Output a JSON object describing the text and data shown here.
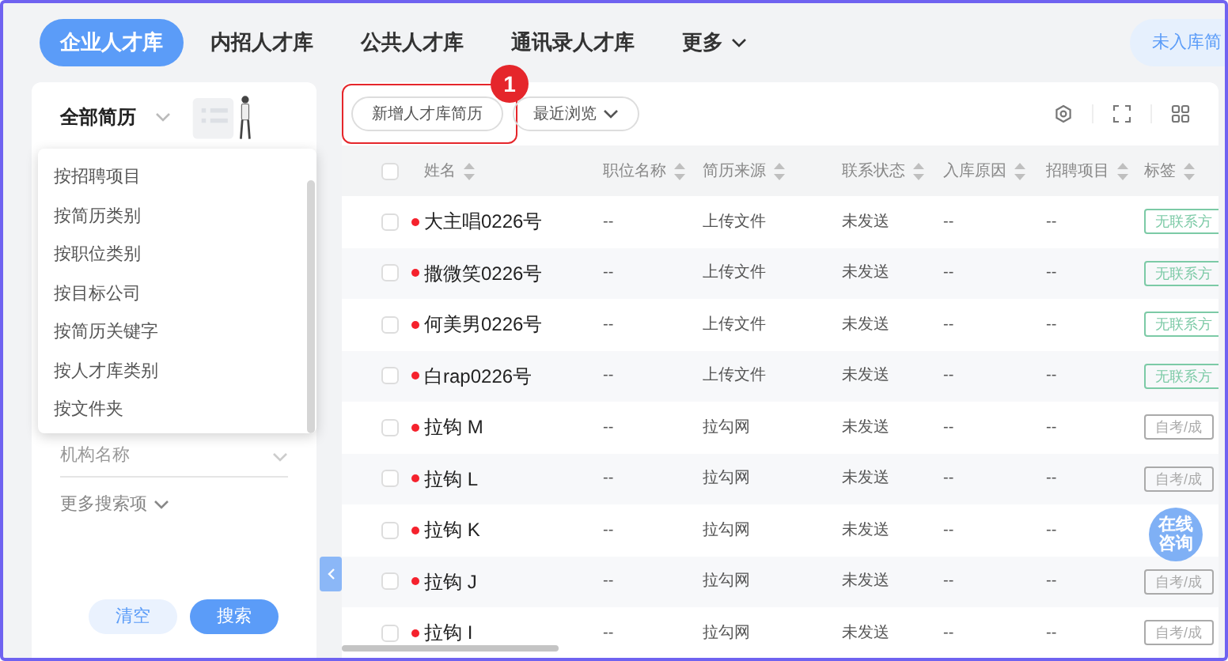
{
  "tabs": [
    {
      "label": "企业人才库",
      "selected": true
    },
    {
      "label": "内招人才库",
      "selected": false
    },
    {
      "label": "公共人才库",
      "selected": false
    },
    {
      "label": "通讯录人才库",
      "selected": false
    },
    {
      "label": "更多",
      "selected": false,
      "kind": "dropdown"
    }
  ],
  "top_right_button": "未入库简",
  "sidebar": {
    "title": "全部简历",
    "menu": [
      "按招聘项目",
      "按简历类别",
      "按职位类别",
      "按目标公司",
      "按简历关键字",
      "按人才库类别",
      "按文件夹"
    ],
    "field_placeholder": "机构名称",
    "more": "更多搜索项",
    "buttons": [
      {
        "label": "清空",
        "kind": "secondary"
      },
      {
        "label": "搜索",
        "kind": "primary"
      }
    ]
  },
  "toolbar": {
    "buttons": [
      {
        "label": "新增人才库简历",
        "kind": "plain",
        "highlighted": true,
        "callout": "1"
      },
      {
        "label": "最近浏览",
        "kind": "dropdown",
        "highlighted": false
      }
    ]
  },
  "table": {
    "columns": [
      "姓名",
      "职位名称",
      "简历来源",
      "联系状态",
      "入库原因",
      "招聘项目",
      "标签"
    ],
    "select_all_checked": false,
    "rows": [
      {
        "checked": false,
        "cells": [
          "大主唱0226号",
          "--",
          "上传文件",
          "未发送",
          "--",
          "--"
        ],
        "tag": "无联系方",
        "color": "#7ccaa6"
      },
      {
        "checked": false,
        "cells": [
          "撒微笑0226号",
          "--",
          "上传文件",
          "未发送",
          "--",
          "--"
        ],
        "tag": "无联系方",
        "color": "#7ccaa6"
      },
      {
        "checked": false,
        "cells": [
          "何美男0226号",
          "--",
          "上传文件",
          "未发送",
          "--",
          "--"
        ],
        "tag": "无联系方",
        "color": "#7ccaa6"
      },
      {
        "checked": false,
        "cells": [
          "白rap0226号",
          "--",
          "上传文件",
          "未发送",
          "--",
          "--"
        ],
        "tag": "无联系方",
        "color": "#7ccaa6"
      },
      {
        "checked": false,
        "cells": [
          "拉钩 M",
          "--",
          "拉勾网",
          "未发送",
          "--",
          "--"
        ],
        "tag": "自考/成",
        "color": "#aaaaaa"
      },
      {
        "checked": false,
        "cells": [
          "拉钩 L",
          "--",
          "拉勾网",
          "未发送",
          "--",
          "--"
        ],
        "tag": "自考/成",
        "color": "#aaaaaa"
      },
      {
        "checked": false,
        "cells": [
          "拉钩 K",
          "--",
          "拉勾网",
          "未发送",
          "--",
          "--"
        ]
      },
      {
        "checked": false,
        "cells": [
          "拉钩 J",
          "--",
          "拉勾网",
          "未发送",
          "--",
          "--"
        ],
        "tag": "自考/成",
        "color": "#aaaaaa"
      },
      {
        "checked": false,
        "cells": [
          "拉钩 I",
          "--",
          "拉勾网",
          "未发送",
          "--",
          "--"
        ],
        "tag": "自考/成",
        "color": "#aaaaaa"
      }
    ]
  },
  "consult_bubble": "在线咨询"
}
